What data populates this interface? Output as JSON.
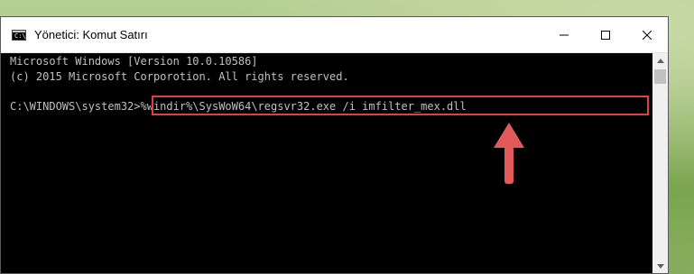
{
  "window": {
    "title": "Yönetici: Komut Satırı",
    "icon_text": "C:\\",
    "controls": [
      "minimize-icon",
      "maximize-icon",
      "close-icon"
    ]
  },
  "console": {
    "lines": [
      "Microsoft Windows [Version 10.0.10586]",
      "(c) 2015 Microsoft Corporotion. All rights reserved.",
      ""
    ],
    "prompt": "C:\\WINDOWS\\system32>",
    "command": "%windir%\\SysWoW64\\regsvr32.exe /i imfilter_mex.dll"
  },
  "annotation": {
    "highlight_color": "#e04040",
    "arrow_icon": "arrow-up-icon"
  },
  "colors": {
    "console_bg": "#000000",
    "console_text": "#c0c0c0",
    "titlebar_bg": "#ffffff"
  }
}
